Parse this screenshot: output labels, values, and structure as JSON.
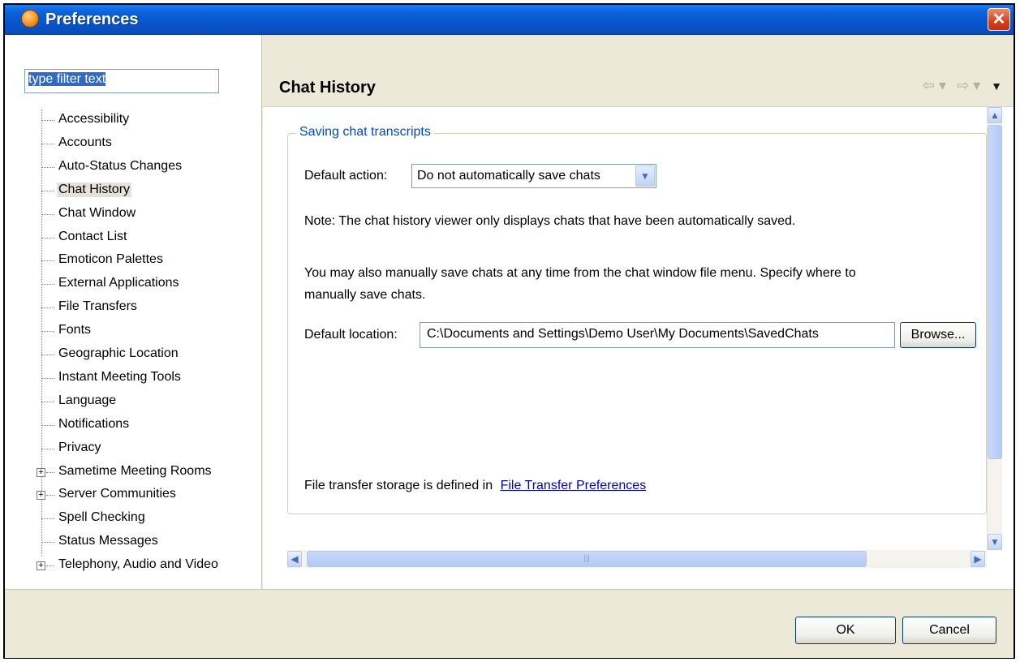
{
  "window": {
    "title": "Preferences",
    "close_glyph": "✕"
  },
  "sidebar": {
    "filter_value": "type filter text",
    "items": [
      {
        "label": "Accessibility",
        "expandable": false
      },
      {
        "label": "Accounts",
        "expandable": false
      },
      {
        "label": "Auto-Status Changes",
        "expandable": false
      },
      {
        "label": "Chat History",
        "expandable": false,
        "selected": true
      },
      {
        "label": "Chat Window",
        "expandable": false
      },
      {
        "label": "Contact List",
        "expandable": false
      },
      {
        "label": "Emoticon Palettes",
        "expandable": false
      },
      {
        "label": "External Applications",
        "expandable": false
      },
      {
        "label": "File Transfers",
        "expandable": false
      },
      {
        "label": "Fonts",
        "expandable": false
      },
      {
        "label": "Geographic Location",
        "expandable": false
      },
      {
        "label": "Instant Meeting Tools",
        "expandable": false
      },
      {
        "label": "Language",
        "expandable": false
      },
      {
        "label": "Notifications",
        "expandable": false
      },
      {
        "label": "Privacy",
        "expandable": false
      },
      {
        "label": "Sametime Meeting Rooms",
        "expandable": true
      },
      {
        "label": "Server Communities",
        "expandable": true
      },
      {
        "label": "Spell Checking",
        "expandable": false
      },
      {
        "label": "Status Messages",
        "expandable": false
      },
      {
        "label": "Telephony, Audio and Video",
        "expandable": true
      }
    ]
  },
  "header": {
    "title": "Chat History",
    "back_glyph": "⇦ ▾",
    "forward_glyph": "⇨ ▾",
    "menu_glyph": "▼"
  },
  "main": {
    "group_title": "Saving chat transcripts",
    "default_action_label": "Default action:",
    "default_action_value": "Do not automatically save chats",
    "note": "Note: The chat history viewer only displays chats that have been automatically saved.",
    "manual_line1": "You may also manually save chats at any time from the chat window file menu. Specify where to",
    "manual_line2": "manually save chats.",
    "location_label": "Default location:",
    "location_value": "C:\\Documents and Settings\\Demo User\\My Documents\\SavedChats",
    "browse_label": "Browse...",
    "file_transfer_text": "File transfer storage is defined in",
    "file_transfer_link": "File Transfer Preferences"
  },
  "footer": {
    "ok_label": "OK",
    "cancel_label": "Cancel"
  },
  "colors": {
    "titlebar": "#0653c8",
    "selection": "#316ac5",
    "link": "#0000cc",
    "group_title": "#0046d5"
  }
}
